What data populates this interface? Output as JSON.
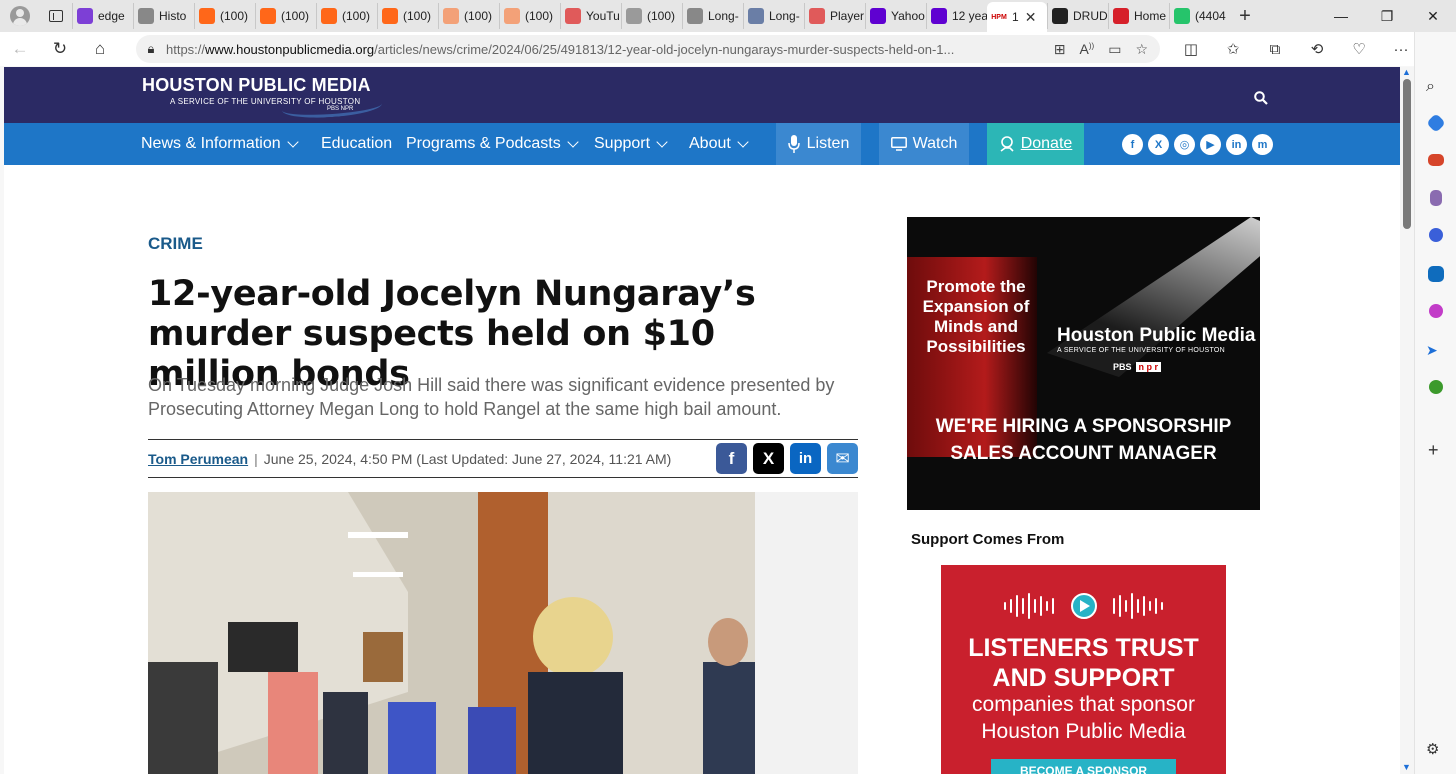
{
  "browser": {
    "tabs": [
      {
        "label": "edge",
        "icon": "yahoo-icon",
        "color": "#7d3fd6"
      },
      {
        "label": "Histo",
        "icon": "history-icon",
        "color": "#888888"
      },
      {
        "label": "(100)",
        "icon": "substack-icon",
        "color": "#ff6719"
      },
      {
        "label": "(100)",
        "icon": "substack-icon",
        "color": "#ff6719"
      },
      {
        "label": "(100)",
        "icon": "substack-icon",
        "color": "#ff6719"
      },
      {
        "label": "(100)",
        "icon": "substack-icon",
        "color": "#ff6719"
      },
      {
        "label": "(100)",
        "icon": "substack-icon",
        "color": "#f3a178"
      },
      {
        "label": "(100)",
        "icon": "substack-icon",
        "color": "#f3a178"
      },
      {
        "label": "YouTu",
        "icon": "youtube-icon",
        "color": "#e05a5a"
      },
      {
        "label": "(100)",
        "icon": "reader-icon",
        "color": "#9a9a9a"
      },
      {
        "label": "Long-",
        "icon": "longform-icon",
        "color": "#888888"
      },
      {
        "label": "Long-",
        "icon": "l-icon",
        "color": "#6a7ea6"
      },
      {
        "label": "Player",
        "icon": "youtube-icon",
        "color": "#e05a5a"
      },
      {
        "label": "Yahoo",
        "icon": "yahoo-icon",
        "color": "#5f01d1"
      },
      {
        "label": "12 yea",
        "icon": "yahoo-icon",
        "color": "#5f01d1"
      },
      {
        "label": "1",
        "icon": "hpm-icon",
        "color": "#ffffff",
        "active": true
      },
      {
        "label": "DRUD",
        "icon": "drudge-icon",
        "color": "#222222"
      },
      {
        "label": "Home",
        "icon": "mic-icon",
        "color": "#d6202a"
      },
      {
        "label": "(4404",
        "icon": "g-icon",
        "color": "#26c46b"
      }
    ],
    "url_prefix": "https://",
    "url_domain": "www.houstonpublicmedia.org",
    "url_path": "/articles/news/crime/2024/06/25/491813/12-year-old-jocelyn-nungarays-murder-suspects-held-on-1...",
    "window_controls": {
      "minimize": "—",
      "restore": "❐",
      "close": "✕"
    },
    "new_tab": "+"
  },
  "site": {
    "logo_line1": "HOUSTON PUBLIC MEDIA",
    "logo_line2": "A SERVICE OF THE UNIVERSITY OF HOUSTON",
    "logo_line3": "PBS NPR",
    "nav": {
      "news": "News & Information",
      "education": "Education",
      "programs": "Programs & Podcasts",
      "support": "Support",
      "about": "About",
      "listen": "Listen",
      "watch": "Watch",
      "donate": "Donate"
    },
    "social": [
      "f",
      "X",
      "◎",
      "▶",
      "in",
      "m"
    ],
    "colors": {
      "header": "#2b2a64",
      "nav": "#1e76c7",
      "donate": "#2cb6b6",
      "listen": "#3b88d0"
    }
  },
  "article": {
    "kicker": "CRIME",
    "headline": "12-year-old Jocelyn Nungaray’s murder suspects held on $10 million bonds",
    "dek": "On Tuesday morning Judge Josh Hill said there was significant evidence presented by Prosecuting Attorney Megan Long to hold Rangel at the same high bail amount.",
    "author": "Tom Perumean",
    "separator": "|",
    "dateline": "June 25, 2024, 4:50 PM (Last Updated: June 27, 2024, 11:21 AM)",
    "share": {
      "facebook": "f",
      "x": "X",
      "linkedin": "in",
      "email": "✉"
    }
  },
  "sidebar": {
    "ad1": {
      "tagline": "Promote the Expansion of Minds and Possibilities",
      "brand": "Houston Public Media",
      "brand_sub": "A SERVICE OF THE UNIVERSITY OF HOUSTON",
      "pbs": "PBS",
      "npr": "n p r",
      "hiring": "WE'RE HIRING A SPONSORSHIP SALES ACCOUNT MANAGER"
    },
    "support_label": "Support Comes From",
    "ad2": {
      "title": "LISTENERS TRUST AND SUPPORT",
      "body": "companies that sponsor Houston Public Media",
      "cta": "BECOME A SPONSOR"
    }
  }
}
